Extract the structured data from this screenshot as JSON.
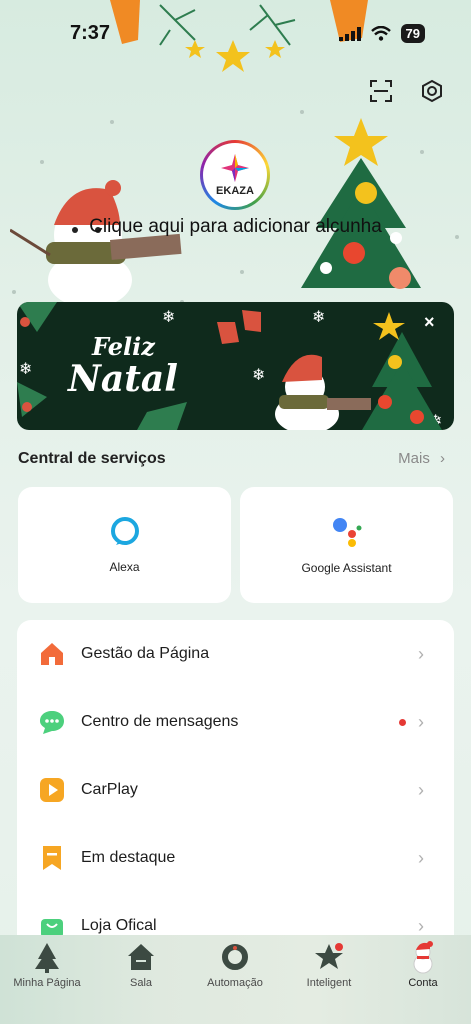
{
  "status_bar": {
    "time": "7:37",
    "battery": "79"
  },
  "profile": {
    "logo_text": "EKAZA",
    "nickname_prompt": "Clique aqui para adicionar alcunha"
  },
  "banner": {
    "line1": "Feliz",
    "line2": "Natal",
    "close": "×"
  },
  "services": {
    "title": "Central de serviços",
    "more": "Mais",
    "items": [
      {
        "label": "Alexa"
      },
      {
        "label": "Google Assistant"
      }
    ]
  },
  "menu": [
    {
      "label": "Gestão da Página",
      "icon": "home-icon",
      "color": "#f26b3a"
    },
    {
      "label": "Centro de mensagens",
      "icon": "chat-icon",
      "color": "#4cd07d",
      "badge": true
    },
    {
      "label": "CarPlay",
      "icon": "play-icon",
      "color": "#f6a623"
    },
    {
      "label": "Em destaque",
      "icon": "bookmark-icon",
      "color": "#f6a623"
    },
    {
      "label": "Loja Ofical",
      "icon": "bag-icon",
      "color": "#4cd07d"
    }
  ],
  "tabs": [
    {
      "label": "Minha Página"
    },
    {
      "label": "Sala"
    },
    {
      "label": "Automação"
    },
    {
      "label": "Inteligent"
    },
    {
      "label": "Conta",
      "active": true
    }
  ]
}
